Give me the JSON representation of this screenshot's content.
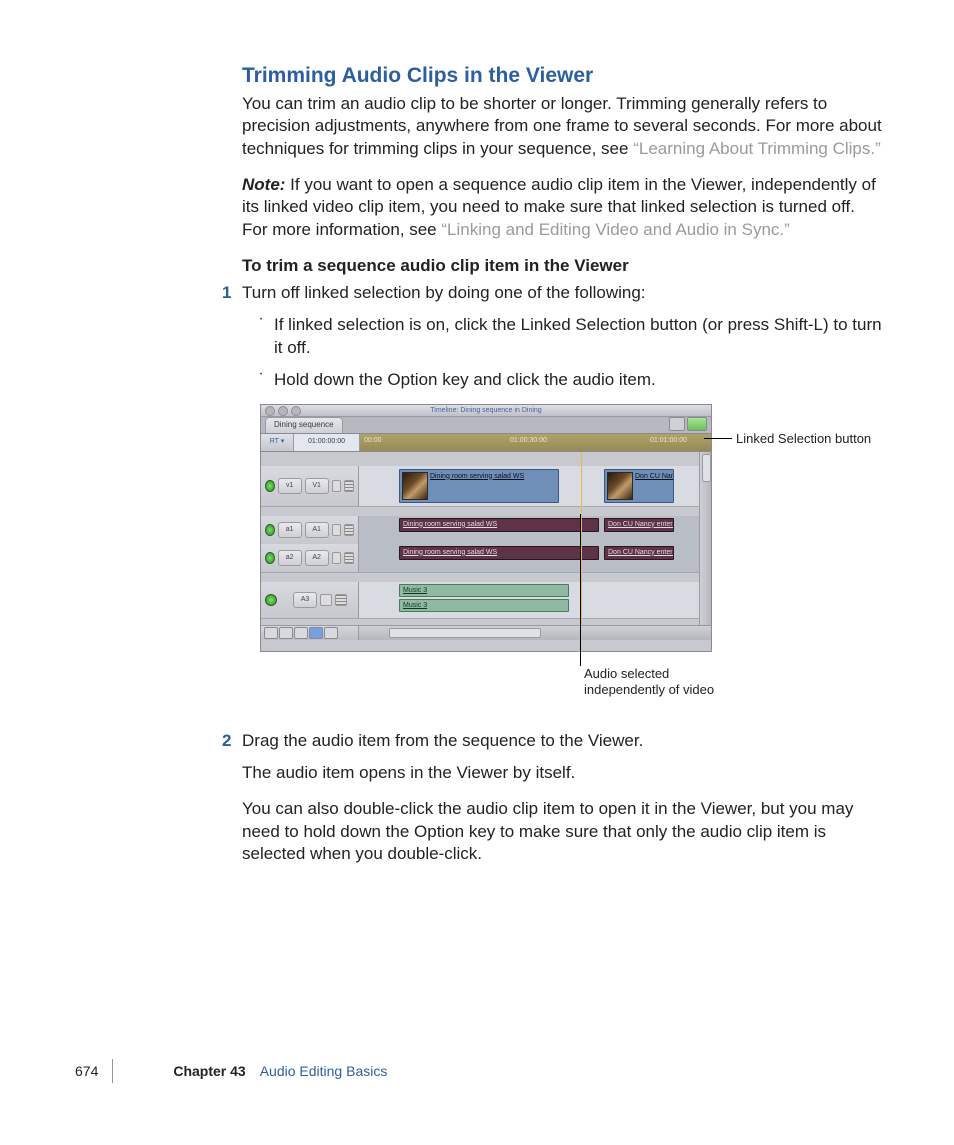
{
  "heading": "Trimming Audio Clips in the Viewer",
  "intro_p1_a": "You can trim an audio clip to be shorter or longer. Trimming generally refers to precision adjustments, anywhere from one frame to several seconds. For more about techniques for trimming clips in your sequence, see ",
  "intro_p1_link": "“Learning About Trimming Clips.”",
  "note_label": "Note:  ",
  "note_text_a": "If you want to open a sequence audio clip item in the Viewer, independently of its linked video clip item, you need to make sure that linked selection is turned off. For more information, see ",
  "note_link": "“Linking and Editing Video and Audio in Sync.”",
  "steps_title": "To trim a sequence audio clip item in the Viewer",
  "step1_num": "1",
  "step1_text": "Turn off linked selection by doing one of the following:",
  "bullet1": "If linked selection is on, click the Linked Selection button (or press Shift-L) to turn it off.",
  "bullet2": "Hold down the Option key and click the audio item.",
  "step2_num": "2",
  "step2_text": "Drag the audio item from the sequence to the Viewer.",
  "step2_p2": "The audio item opens in the Viewer by itself.",
  "step2_p3": "You can also double-click the audio clip item to open it in the Viewer, but you may need to hold down the Option key to make sure that only the audio clip item is selected when you double-click.",
  "timeline": {
    "title": "Timeline: Dining sequence in Dining",
    "tab": "Dining sequence",
    "rt": "RT ▾",
    "tc": "01:00:00:00",
    "tick1": "00:00",
    "tick2": "01:00:30:00",
    "tick3": "01:01:00:00",
    "v1_src": "v1",
    "v1_dst": "V1",
    "a1_src": "a1",
    "a1_dst": "A1",
    "a2_src": "a2",
    "a2_dst": "A2",
    "a3_dst": "A3",
    "clip_v1a": "Dining room serving salad WS",
    "clip_v1b": "Don CU Nancy enters",
    "clip_a": "Dining room serving salad WS",
    "clip_ab": "Don CU Nancy enters",
    "clip_music": "Music 3"
  },
  "callout_linked": "Linked Selection button",
  "callout_audio1": "Audio selected",
  "callout_audio2": "independently of video",
  "footer": {
    "page": "674",
    "chapter": "Chapter 43",
    "title": "Audio Editing Basics"
  }
}
